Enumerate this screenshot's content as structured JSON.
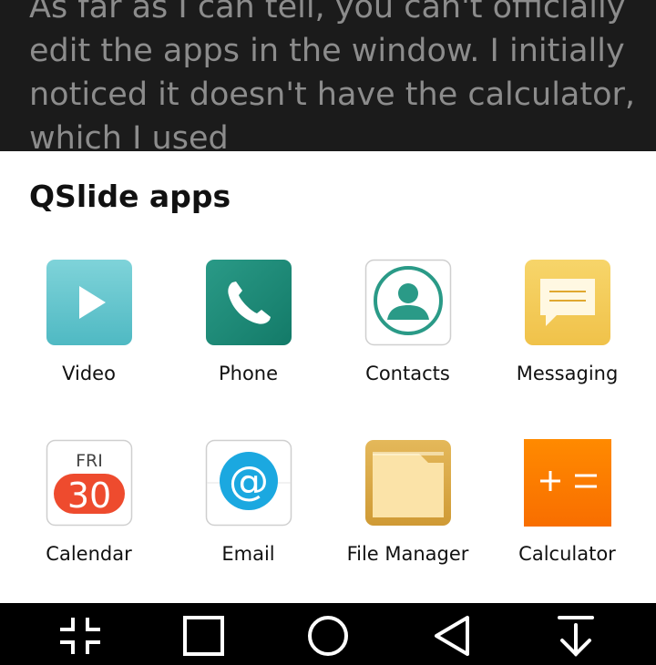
{
  "background_text": "As far as I can tell, you can't officially edit the apps in the window. I initially noticed it doesn't have the calculator, which I used",
  "sheet": {
    "title": "QSlide apps"
  },
  "apps": [
    {
      "label": "Video",
      "icon": "video-play-icon"
    },
    {
      "label": "Phone",
      "icon": "phone-handset-icon"
    },
    {
      "label": "Contacts",
      "icon": "contacts-person-icon"
    },
    {
      "label": "Messaging",
      "icon": "message-bubble-icon"
    },
    {
      "label": "Calendar",
      "icon": "calendar-icon",
      "day": "FRI",
      "date": "30"
    },
    {
      "label": "Email",
      "icon": "at-sign-icon",
      "glyph": "@"
    },
    {
      "label": "File Manager",
      "icon": "folder-icon"
    },
    {
      "label": "Calculator",
      "icon": "calculator-icon"
    }
  ],
  "navbar": {
    "buttons": [
      "qslide-collapse-icon",
      "recents-square-icon",
      "home-circle-icon",
      "back-triangle-icon",
      "notification-pull-down-icon"
    ]
  }
}
